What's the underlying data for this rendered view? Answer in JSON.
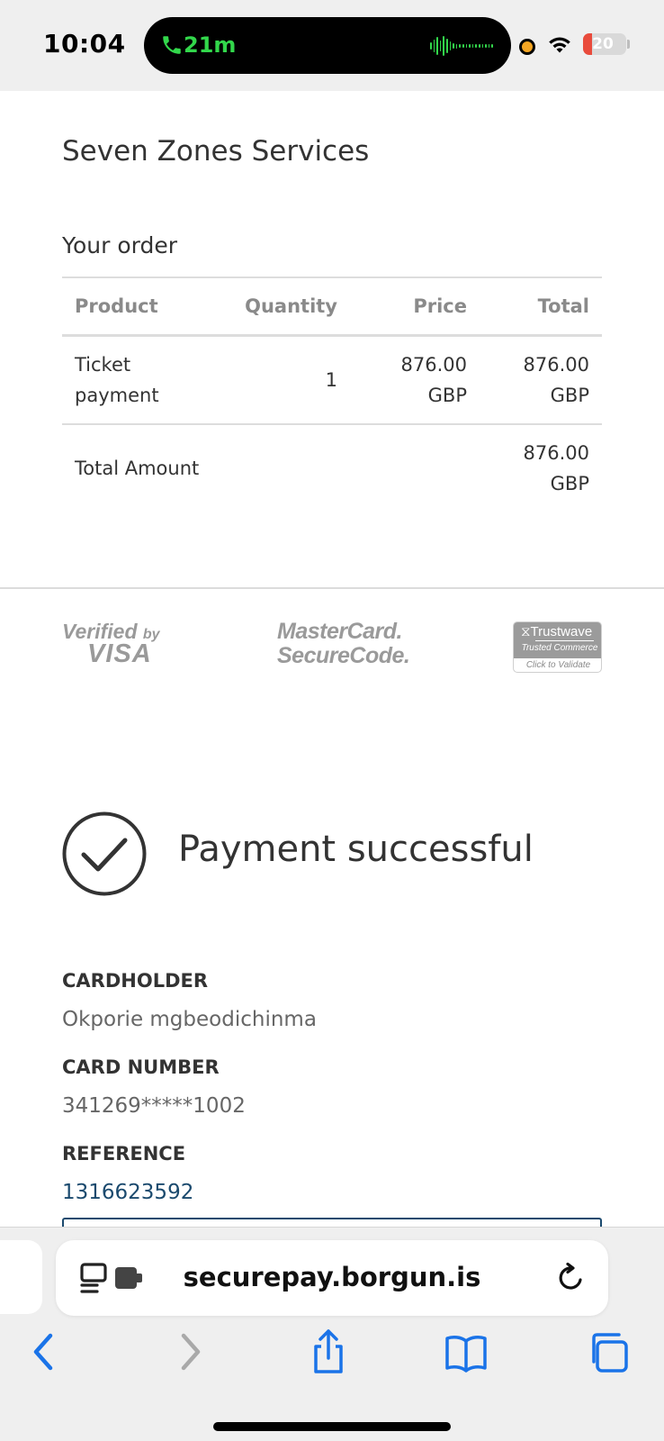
{
  "status_bar": {
    "time": "10:04",
    "call_duration": "21m",
    "battery_level": "20",
    "battery_fraction": 0.2
  },
  "page": {
    "merchant_name": "Seven Zones Services",
    "order_title": "Your order",
    "table": {
      "headers": [
        "Product",
        "Quantity",
        "Price",
        "Total"
      ],
      "rows": [
        {
          "product": "Ticket payment",
          "quantity": "1",
          "price": "876.00 GBP",
          "total": "876.00 GBP"
        }
      ],
      "total_label": "Total Amount",
      "total_value": "876.00 GBP"
    },
    "logos": {
      "visa_line1": "Verified",
      "visa_by": "by",
      "visa_line2": "VISA",
      "mastercard_line1": "MasterCard.",
      "mastercard_line2": "SecureCode.",
      "trustwave_name": "Trustwave",
      "trustwave_sub": "Trusted Commerce",
      "trustwave_validate": "Click to Validate"
    },
    "status_text": "Payment successful",
    "details": {
      "cardholder_label": "CARDHOLDER",
      "cardholder_value": "Okporie mgbeodichinma",
      "card_number_label": "CARD NUMBER",
      "card_number_value": "341269*****1002",
      "reference_label": "REFERENCE",
      "reference_value": "1316623592"
    }
  },
  "browser": {
    "url": "securepay.borgun.is"
  },
  "colors": {
    "accent_link": "#1b4a6e",
    "ios_blue": "#1a73e8",
    "call_green": "#32d74b",
    "battery_red": "#e94b3c"
  }
}
